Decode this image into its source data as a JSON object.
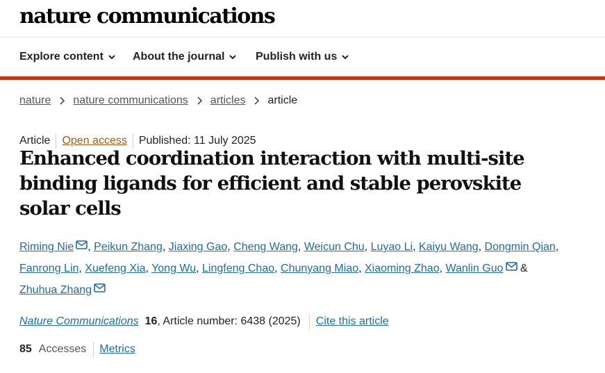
{
  "brand": "nature communications",
  "nav": [
    {
      "label": "Explore content"
    },
    {
      "label": "About the journal"
    },
    {
      "label": "Publish with us"
    }
  ],
  "breadcrumb": {
    "items": [
      "nature",
      "nature communications",
      "articles"
    ],
    "current": "article"
  },
  "meta": {
    "type": "Article",
    "access": "Open access",
    "published": "Published: 11 July 2025"
  },
  "title": "Enhanced coordination interaction with multi-site binding ligands for efficient and stable perovskite solar cells",
  "authors": [
    {
      "name": "Riming Nie",
      "email": true
    },
    {
      "name": "Peikun Zhang",
      "email": false
    },
    {
      "name": "Jiaxing Gao",
      "email": false
    },
    {
      "name": "Cheng Wang",
      "email": false
    },
    {
      "name": "Weicun Chu",
      "email": false
    },
    {
      "name": "Luyao Li",
      "email": false
    },
    {
      "name": "Kaiyu Wang",
      "email": false
    },
    {
      "name": "Dongmin Qian",
      "email": false
    },
    {
      "name": "Fanrong Lin",
      "email": false
    },
    {
      "name": "Xuefeng Xia",
      "email": false
    },
    {
      "name": "Yong Wu",
      "email": false
    },
    {
      "name": "Lingfeng Chao",
      "email": false
    },
    {
      "name": "Chunyang Miao",
      "email": false
    },
    {
      "name": "Xiaoming Zhao",
      "email": false
    },
    {
      "name": "Wanlin Guo",
      "email": true
    },
    {
      "name": "Zhuhua Zhang",
      "email": true
    }
  ],
  "author_separator": ",",
  "author_and": "&",
  "citation": {
    "journal": "Nature Communications",
    "volume": "16",
    "rest": ", Article number: 6438 (2025)",
    "cite_label": "Cite this article"
  },
  "metrics": {
    "accesses_count": "85",
    "accesses_label": "Accesses",
    "metrics_label": "Metrics"
  },
  "colors": {
    "accent": "#c2350e",
    "link": "#1f6c9d",
    "open_access": "#a35b17"
  },
  "icons": {
    "nav_dropdown": "chevron-down-icon",
    "breadcrumb_separator": "chevron-right-icon",
    "author_contact": "mail-icon"
  }
}
